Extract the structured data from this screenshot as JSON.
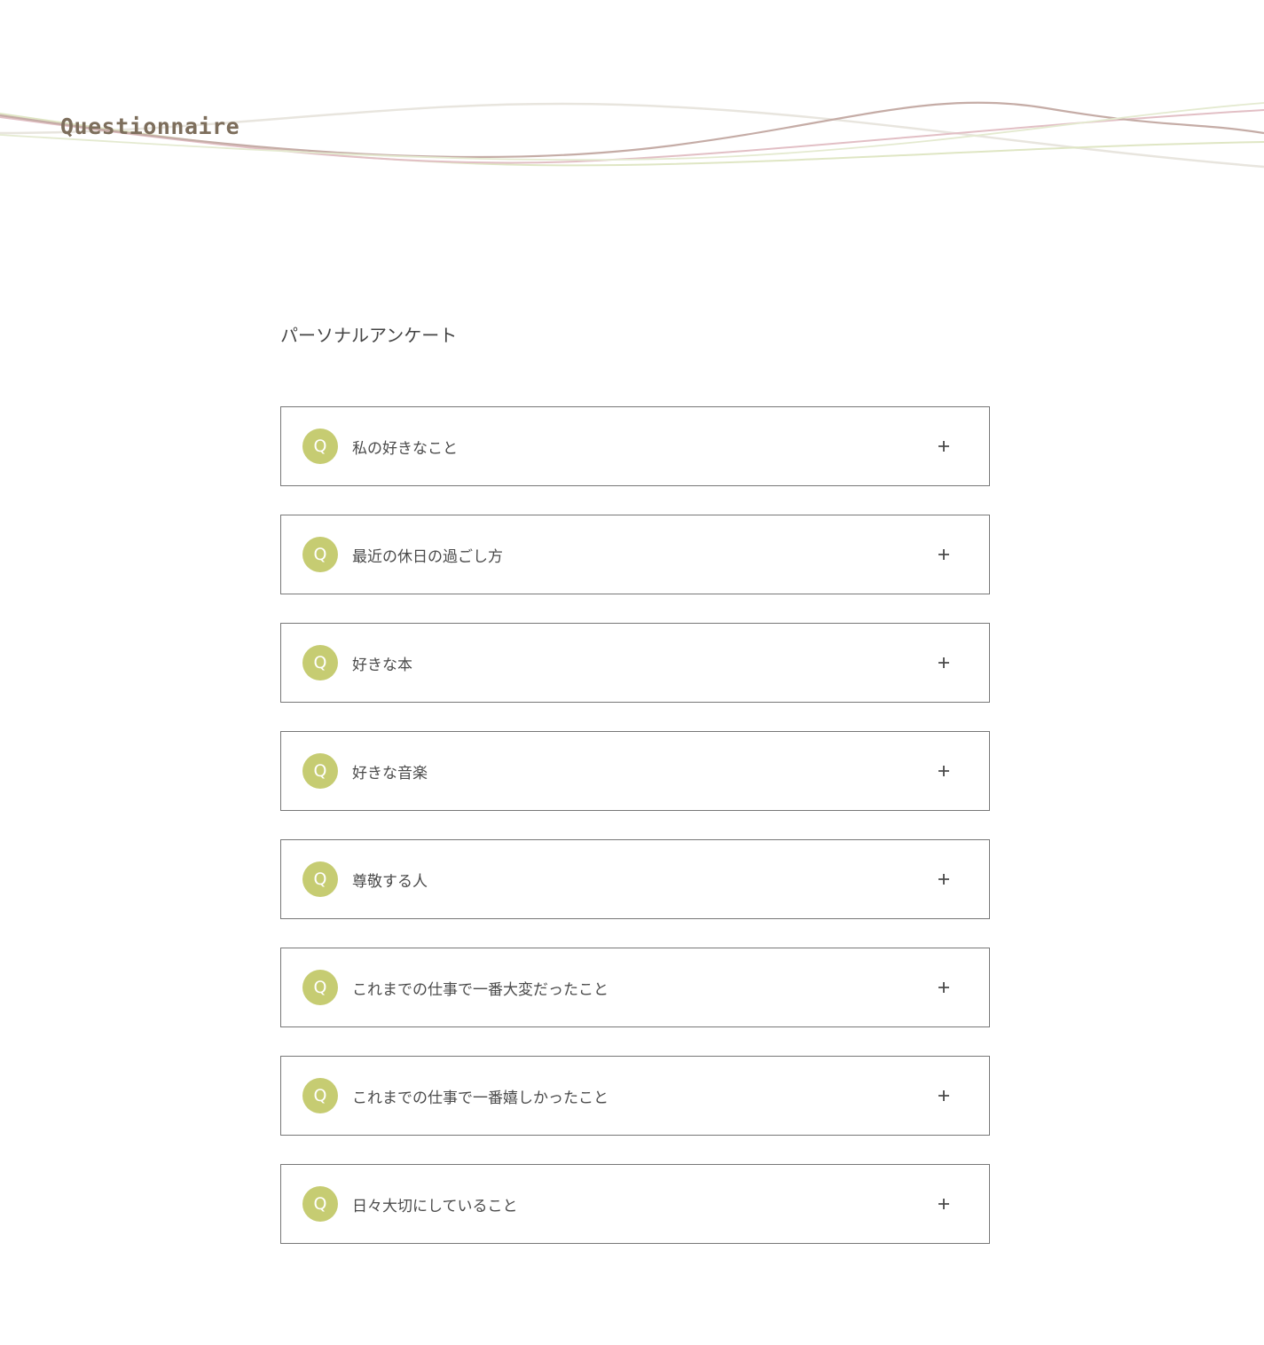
{
  "header": {
    "site_title": "Questionnaire"
  },
  "section": {
    "title": "パーソナルアンケート"
  },
  "faq": {
    "badge_label": "Q",
    "expand_icon": "plus-icon",
    "items": [
      {
        "question": "私の好きなこと"
      },
      {
        "question": "最近の休日の過ごし方"
      },
      {
        "question": "好きな本"
      },
      {
        "question": "好きな音楽"
      },
      {
        "question": "尊敬する人"
      },
      {
        "question": "これまでの仕事で一番大変だったこと"
      },
      {
        "question": "これまでの仕事で一番嬉しかったこと"
      },
      {
        "question": "日々大切にしていること"
      }
    ]
  },
  "colors": {
    "badge": "#c6cc72",
    "title": "#7d6e5c",
    "border": "#777777",
    "wave_brown": "#b9a09a",
    "wave_pink": "#ddb4bc",
    "wave_green": "#d9e2b8",
    "wave_gray": "#e6e3dc"
  }
}
